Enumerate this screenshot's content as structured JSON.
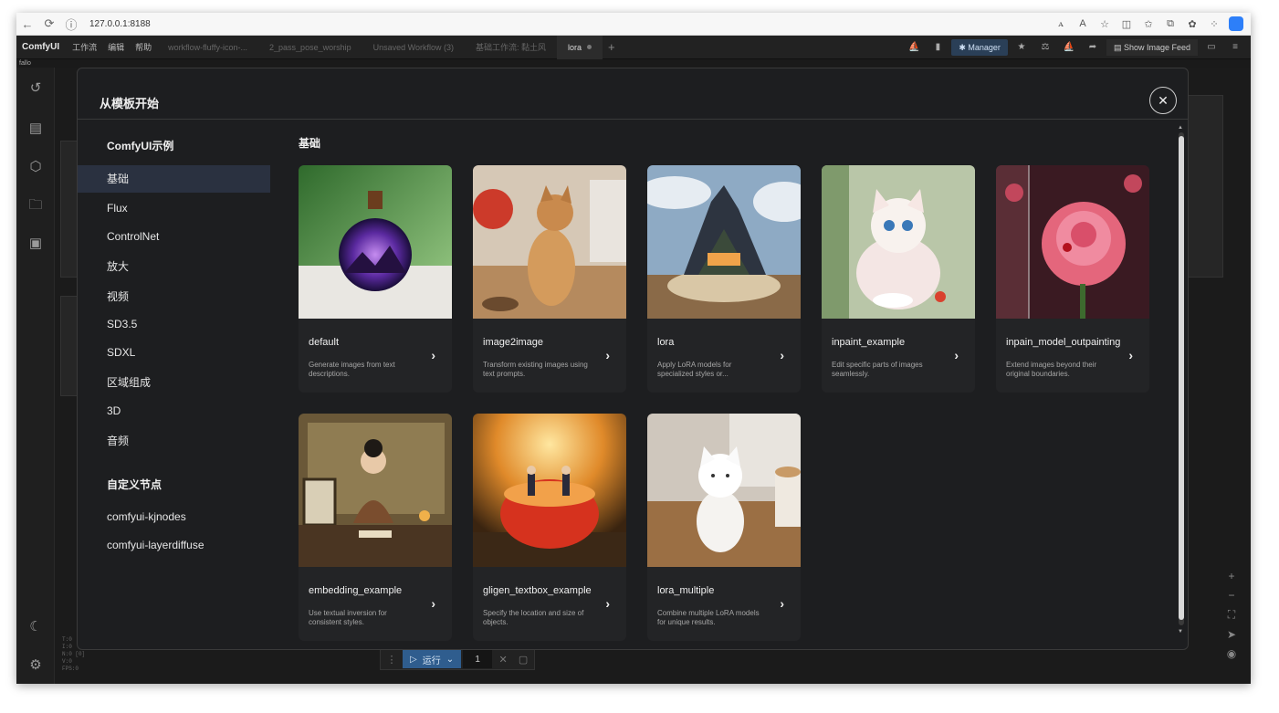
{
  "browser": {
    "url": "127.0.0.1:8188",
    "back_icon": "arrow-left-icon",
    "reload_icon": "reload-icon",
    "info_icon": "info-icon"
  },
  "app": {
    "logo": "ComfyUI",
    "menu": [
      "工作流",
      "编辑",
      "帮助"
    ],
    "workflow_tabs": [
      {
        "label": "workflow-fluffy-icon-..."
      },
      {
        "label": "2_pass_pose_worship"
      },
      {
        "label": "Unsaved Workflow (3)"
      },
      {
        "label": "基础工作流: 黏土风"
      },
      {
        "label": "lora"
      }
    ],
    "active_tab": "lora",
    "manager_label": "Manager",
    "image_feed_label": "Show Image Feed",
    "sub_label": "fallo"
  },
  "modal": {
    "title": "从模板开始",
    "nav": {
      "section1": "ComfyUI示例",
      "items1": [
        "基础",
        "Flux",
        "ControlNet",
        "放大",
        "视频",
        "SD3.5",
        "SDXL",
        "区域组成",
        "3D",
        "音频"
      ],
      "section2": "自定义节点",
      "items2": [
        "comfyui-kjnodes",
        "comfyui-layerdiffuse"
      ],
      "active": "基础"
    },
    "content_heading": "基础",
    "cards": [
      {
        "title": "default",
        "desc": "Generate images from text descriptions."
      },
      {
        "title": "image2image",
        "desc": "Transform existing images using text prompts."
      },
      {
        "title": "lora",
        "desc": "Apply LoRA models for specialized styles or..."
      },
      {
        "title": "inpaint_example",
        "desc": "Edit specific parts of images seamlessly."
      },
      {
        "title": "inpain_model_outpainting",
        "desc": "Extend images beyond their original boundaries."
      },
      {
        "title": "embedding_example",
        "desc": "Use textual inversion for consistent styles."
      },
      {
        "title": "gligen_textbox_example",
        "desc": "Specify the location and size of objects."
      },
      {
        "title": "lora_multiple",
        "desc": "Combine multiple LoRA models for unique results."
      }
    ]
  },
  "run": {
    "label": "运行",
    "count": "1"
  },
  "colors": {
    "accent": "#2f5d8e",
    "modal_bg": "#1d1e20",
    "active_nav": "#2a3140"
  }
}
